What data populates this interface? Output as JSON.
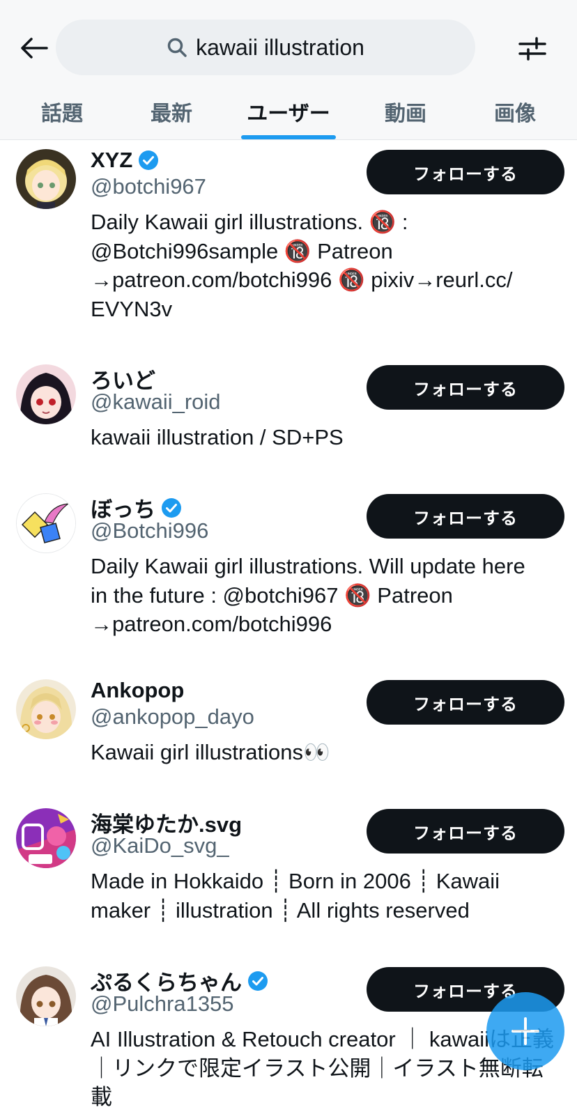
{
  "search": {
    "query": "kawaii illustration"
  },
  "tabs": [
    "話題",
    "最新",
    "ユーザー",
    "動画",
    "画像"
  ],
  "active_tab": "ユーザー",
  "follow_label": "フォローする",
  "colors": {
    "accent": "#1d9bf0",
    "button": "#0f1419",
    "muted": "#536471"
  },
  "users": [
    {
      "name": "XYZ",
      "verified": true,
      "handle": "@botchi967",
      "bio_lines": [
        "Daily Kawaii girl illustrations. 🔞 :",
        "@Botchi996sample 🔞 Patreon",
        "→patreon.com/botchi996 🔞 pixiv→reurl.cc/",
        "EVYN3v"
      ]
    },
    {
      "name": "ろいど",
      "verified": false,
      "handle": "@kawaii_roid",
      "bio_lines": [
        "kawaii illustration / SD+PS"
      ]
    },
    {
      "name": "ぼっち",
      "verified": true,
      "handle": "@Botchi996",
      "bio_lines": [
        "Daily Kawaii girl illustrations. Will update here",
        "in the future : @botchi967 🔞 Patreon",
        "→patreon.com/botchi996"
      ]
    },
    {
      "name": "Ankopop",
      "verified": false,
      "handle": "@ankopop_dayo",
      "bio_lines": [
        "Kawaii girl illustrations👀"
      ]
    },
    {
      "name": "海棠ゆたか.svg",
      "verified": false,
      "handle": "@KaiDo_svg_",
      "bio_lines": [
        "Made in Hokkaido ┊ Born in 2006 ┊ Kawaii",
        "maker ┊ illustration ┊ All rights reserved"
      ]
    },
    {
      "name": "ぷるくらちゃん",
      "verified": true,
      "handle": "@Pulchra1355",
      "bio_lines": [
        "AI Illustration & Retouch creator ｜ kawaiiは正義",
        "｜リンクで限定イラスト公開｜イラスト無断転載"
      ]
    }
  ]
}
